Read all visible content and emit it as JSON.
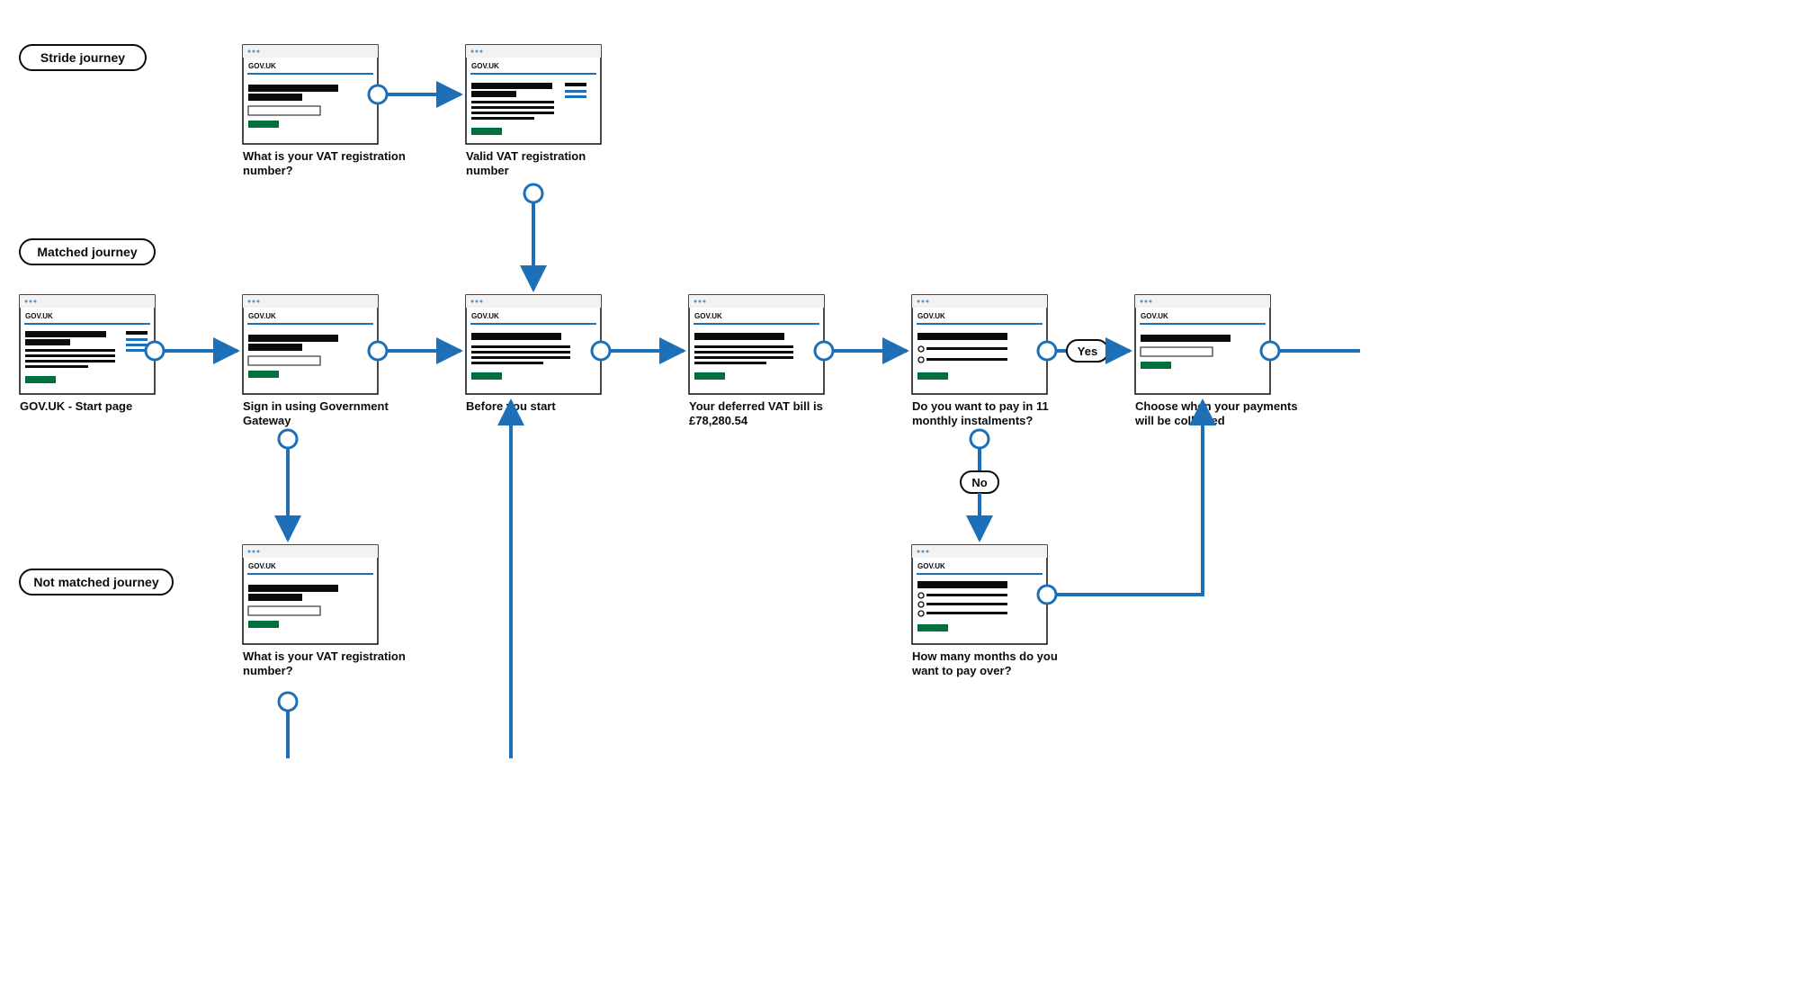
{
  "brand": "GOV.UK",
  "lanes": {
    "stride": {
      "label": "Stride journey"
    },
    "matched": {
      "label": "Matched journey"
    },
    "notmatched": {
      "label": "Not matched journey"
    }
  },
  "decisions": {
    "yes": "Yes",
    "no": "No"
  },
  "screens": {
    "start": {
      "caption1": "GOV.UK - Start page",
      "caption2": "",
      "type": "twocol"
    },
    "signin": {
      "caption1": "Sign in using Government",
      "caption2": "Gateway",
      "type": "input"
    },
    "vatq_stride": {
      "caption1": "What is your VAT registration",
      "caption2": "number?",
      "type": "input"
    },
    "vatvalid": {
      "caption1": "Valid VAT registration",
      "caption2": "number",
      "type": "twocol"
    },
    "before": {
      "caption1": "Before you start",
      "caption2": "",
      "type": "text"
    },
    "bill": {
      "caption1": "Your deferred VAT bill is",
      "caption2": "£78,280.54",
      "type": "text"
    },
    "eleven": {
      "caption1": "Do you want to pay in 11",
      "caption2": "monthly instalments?",
      "type": "radio2"
    },
    "choose": {
      "caption1": "Choose when your payments",
      "caption2": "will be collected",
      "type": "input"
    },
    "months": {
      "caption1": "How many months do you",
      "caption2": "want to pay over?",
      "type": "radio3"
    },
    "vatq_nm": {
      "caption1": "What is your VAT registration",
      "caption2": "number?",
      "type": "input"
    }
  },
  "colors": {
    "connector": "#1d70b8",
    "border": "#0b0c0c",
    "green": "#00703c",
    "blueline": "#2f6fbf"
  }
}
